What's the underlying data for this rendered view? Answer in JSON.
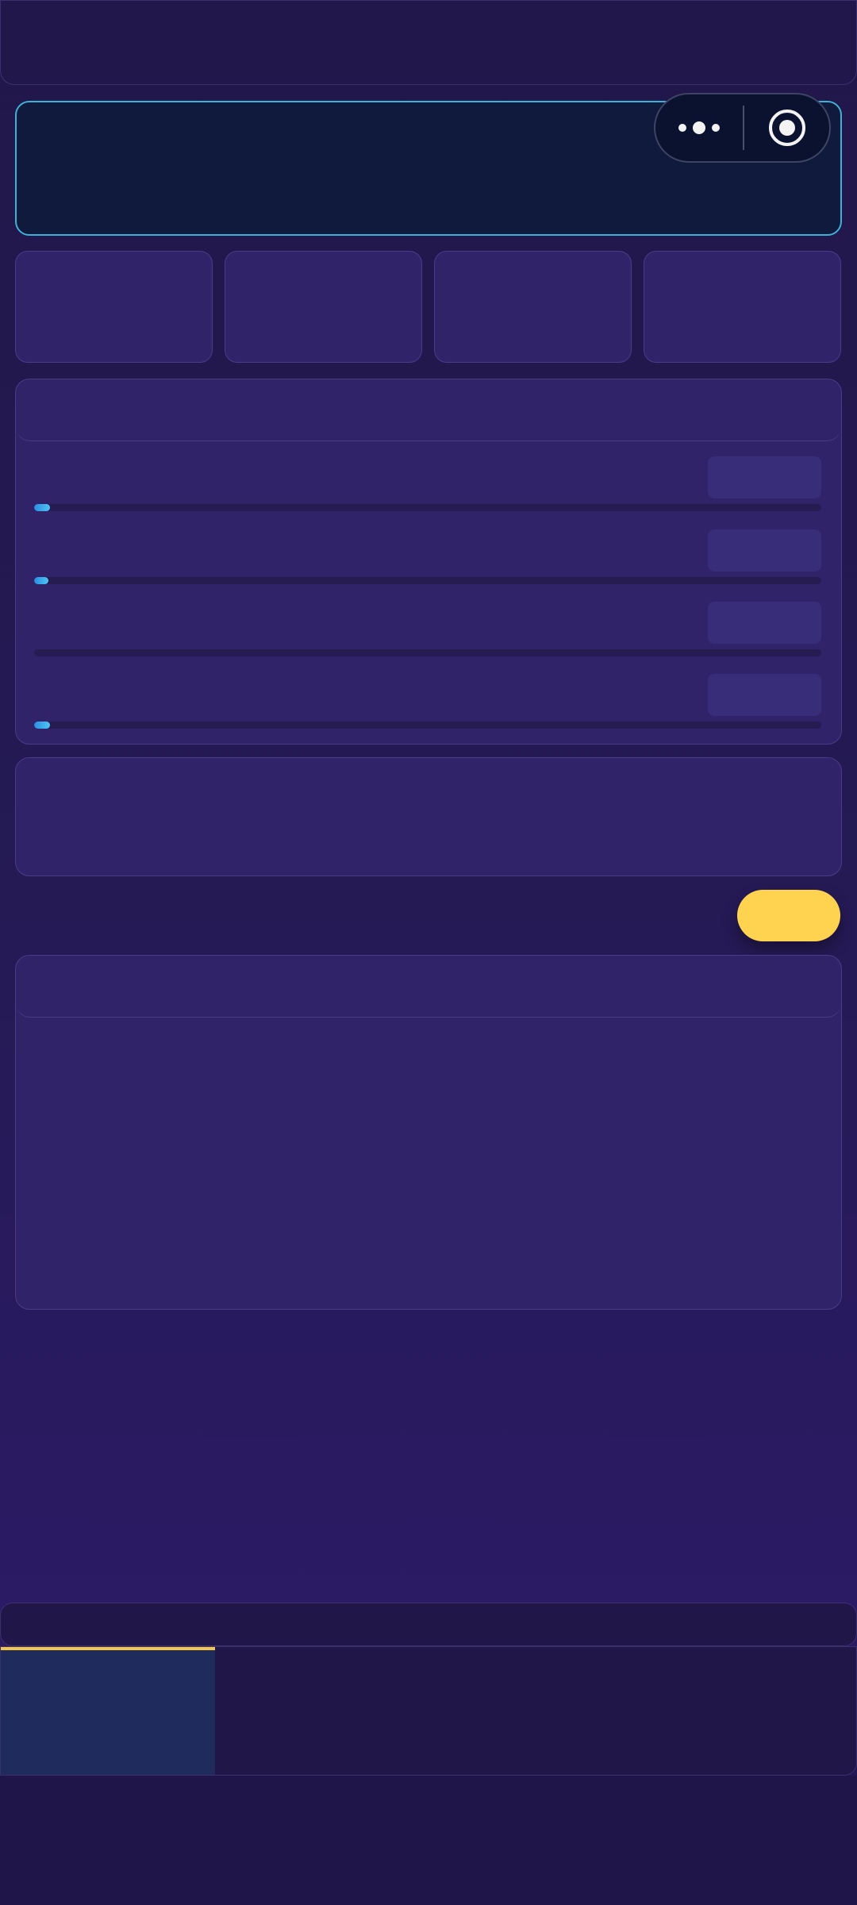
{
  "app": {
    "accent_color": "#3eb1d6",
    "primary_button_color": "#ffd34f",
    "progress_color": "#4fc4f3",
    "background_color": "#251a55"
  },
  "capsule": {
    "more_icon": "more-dots-icon",
    "close_icon": "record-target-icon"
  },
  "progress_rows": [
    {
      "progress": 0.02
    },
    {
      "progress": 0.018
    },
    {
      "progress": 0.0
    },
    {
      "progress": 0.02
    }
  ],
  "tab_bar": {
    "active_index": 0,
    "tab_count": 4
  }
}
